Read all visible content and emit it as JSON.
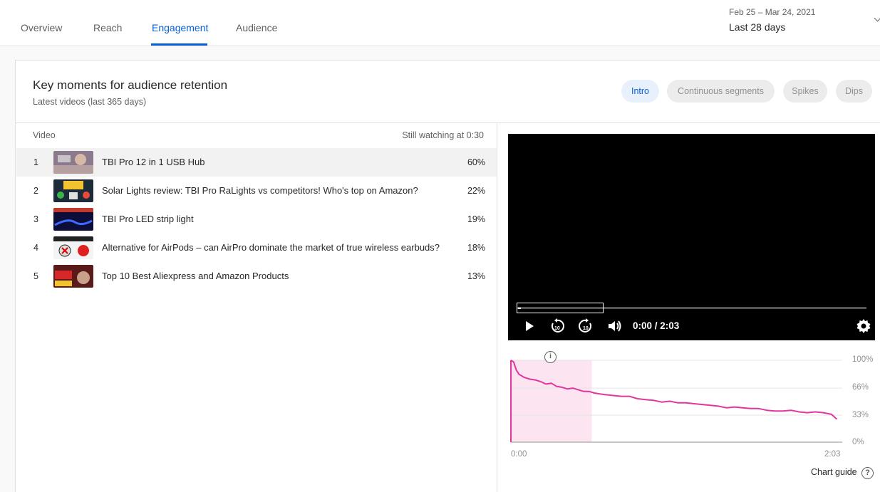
{
  "tabs": [
    {
      "label": "Overview"
    },
    {
      "label": "Reach"
    },
    {
      "label": "Engagement",
      "active": true
    },
    {
      "label": "Audience"
    }
  ],
  "date_range": {
    "sub": "Feb 25 – Mar 24, 2021",
    "main": "Last 28 days"
  },
  "card": {
    "title": "Key moments for audience retention",
    "subtitle": "Latest videos (last 365 days)",
    "chips": [
      {
        "label": "Intro",
        "active": true
      },
      {
        "label": "Continuous segments"
      },
      {
        "label": "Spikes"
      },
      {
        "label": "Dips"
      }
    ]
  },
  "table": {
    "col_video": "Video",
    "col_metric": "Still watching at 0:30",
    "rows": [
      {
        "num": "1",
        "title": "TBI Pro 12 in 1 USB Hub",
        "pct": "60%"
      },
      {
        "num": "2",
        "title": "Solar Lights review: TBI Pro RaLights vs competitors! Who's top on Amazon?",
        "pct": "22%"
      },
      {
        "num": "3",
        "title": "TBI Pro LED strip light",
        "pct": "19%"
      },
      {
        "num": "4",
        "title": "Alternative for AirPods – can AirPro dominate the market of true wireless earbuds?",
        "pct": "18%"
      },
      {
        "num": "5",
        "title": "Top 10 Best Aliexpress and Amazon Products",
        "pct": "13%"
      }
    ]
  },
  "player": {
    "time": "0:00 / 2:03",
    "progress_fraction": 0
  },
  "chart_guide": "Chart guide",
  "colors": {
    "accent": "#065fd4",
    "retention_line": "#e0379f",
    "intro_highlight": "#fce4f0"
  },
  "chart_data": {
    "type": "line",
    "x_label_start": "0:00",
    "x_label_end": "2:03",
    "y_ticks": [
      "100%",
      "66%",
      "33%",
      "0%"
    ],
    "ylim": [
      0,
      100
    ],
    "xlim": [
      0,
      123
    ],
    "highlight_range": [
      0,
      30
    ],
    "series": [
      {
        "x": [
          0,
          1,
          2,
          3,
          5,
          7,
          9,
          11,
          13,
          15,
          17,
          19,
          21,
          23,
          25,
          27,
          29,
          31,
          33,
          35,
          38,
          41,
          44,
          47,
          50,
          53,
          56,
          59,
          62,
          65,
          68,
          71,
          74,
          77,
          80,
          83,
          86,
          89,
          92,
          95,
          98,
          101,
          104,
          107,
          110,
          113,
          116,
          119,
          120,
          121
        ],
        "values": [
          100,
          98,
          88,
          83,
          79,
          77,
          76,
          74,
          71,
          72,
          68,
          67,
          65,
          66,
          64,
          62,
          62,
          60,
          59,
          58,
          57,
          56,
          56,
          53,
          52,
          51,
          49,
          50,
          48,
          48,
          47,
          46,
          45,
          44,
          42,
          43,
          42,
          41,
          41,
          39,
          38,
          38,
          39,
          37,
          36,
          37,
          36,
          34,
          31,
          28
        ]
      }
    ]
  }
}
